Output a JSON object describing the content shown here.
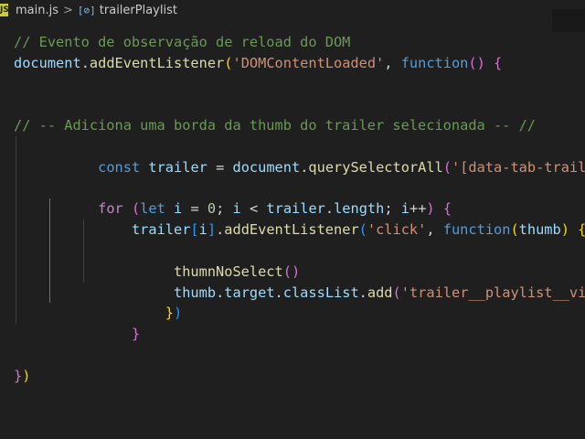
{
  "breadcrumb": {
    "file_icon": "js-file-icon",
    "file_icon_text": "JS",
    "file": "main.js",
    "separator": ">",
    "symbol_icon": "symbol-variable-icon",
    "symbol": "trailerPlaylist"
  },
  "editor": {
    "language": "javascript",
    "theme_background": "#1f1f1f",
    "lines": [
      "// Evento de observação de reload do DOM",
      "document.addEventListener('DOMContentLoaded', function() {",
      "",
      "",
      "// -- Adiciona uma borda da thumb do trailer selecionada -- //",
      "    const trailer = document.querySelectorAll('[data-tab-trailer]')",
      "",
      "    for (let i = 0; i < trailer.length; i++) {",
      "        trailer[i].addEventListener('click', function(thumb) {",
      "",
      "            thumnNoSelect()",
      "            thumb.target.classList.add('trailer__playlist__video__thum",
      "        })",
      "    }",
      "",
      "",
      "})"
    ]
  }
}
